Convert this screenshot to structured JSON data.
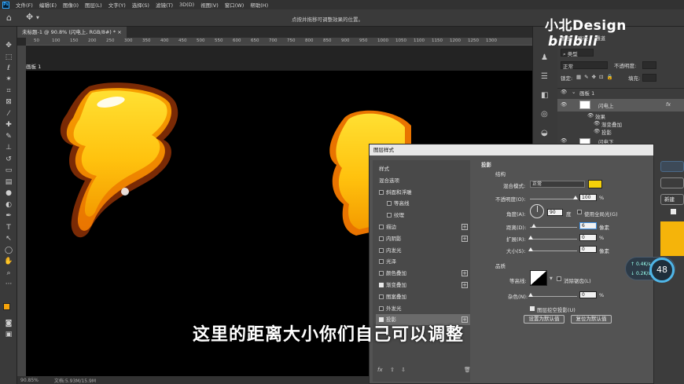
{
  "menubar": {
    "app_icon": "Ps",
    "items": [
      "文件(F)",
      "编辑(E)",
      "图像(I)",
      "图层(L)",
      "文字(Y)",
      "选择(S)",
      "滤镜(T)",
      "3D(D)",
      "视图(V)",
      "窗口(W)",
      "帮助(H)"
    ]
  },
  "options_bar": {
    "hint": "点按并拖移可调整效果的位置。"
  },
  "document": {
    "tab_label": "未标题-1 @ 90.8% (闪电上, RGB/8#) *",
    "artboard_label": "画板 1",
    "ruler_ticks": [
      "50",
      "100",
      "150",
      "200",
      "250",
      "300",
      "350",
      "400",
      "450",
      "500",
      "550",
      "600",
      "650",
      "700",
      "750",
      "800",
      "850",
      "900",
      "950",
      "1000",
      "1050",
      "1100",
      "1150",
      "1200",
      "1250",
      "1300"
    ]
  },
  "status": {
    "zoom": "90.85%",
    "doc_size": "文档:5.93M/15.9M"
  },
  "watermark": {
    "brand": "小北Design",
    "site": "bilibili"
  },
  "layers_panel": {
    "tabs": [
      "图层",
      "路径",
      "通道"
    ],
    "filter_label": "类型",
    "blend_mode": "正常",
    "opacity_label": "不透明度:",
    "lock_label": "锁定:",
    "fill_label": "填充:",
    "rows": [
      {
        "name": "画板 1"
      },
      {
        "name": "闪电上",
        "fx": "fx"
      },
      {
        "name": "效果"
      },
      {
        "name": "渐变叠加"
      },
      {
        "name": "投影"
      },
      {
        "name": "闪电下"
      }
    ]
  },
  "layer_style": {
    "title": "图层样式",
    "left_items": [
      {
        "label": "样式",
        "checkbox": false,
        "checked": false,
        "plus": false,
        "indent": 0
      },
      {
        "label": "混合选项",
        "checkbox": false,
        "checked": false,
        "plus": false,
        "indent": 0
      },
      {
        "label": "斜面和浮雕",
        "checkbox": true,
        "checked": false,
        "plus": false,
        "indent": 0
      },
      {
        "label": "等高线",
        "checkbox": true,
        "checked": false,
        "plus": false,
        "indent": 1
      },
      {
        "label": "纹理",
        "checkbox": true,
        "checked": false,
        "plus": false,
        "indent": 1
      },
      {
        "label": "描边",
        "checkbox": true,
        "checked": false,
        "plus": true,
        "indent": 0
      },
      {
        "label": "内阴影",
        "checkbox": true,
        "checked": false,
        "plus": true,
        "indent": 0
      },
      {
        "label": "内发光",
        "checkbox": true,
        "checked": false,
        "plus": false,
        "indent": 0
      },
      {
        "label": "光泽",
        "checkbox": true,
        "checked": false,
        "plus": false,
        "indent": 0
      },
      {
        "label": "颜色叠加",
        "checkbox": true,
        "checked": false,
        "plus": true,
        "indent": 0
      },
      {
        "label": "渐变叠加",
        "checkbox": true,
        "checked": true,
        "plus": true,
        "indent": 0
      },
      {
        "label": "图案叠加",
        "checkbox": true,
        "checked": false,
        "plus": false,
        "indent": 0
      },
      {
        "label": "外发光",
        "checkbox": true,
        "checked": false,
        "plus": false,
        "indent": 0
      },
      {
        "label": "投影",
        "checkbox": true,
        "checked": true,
        "plus": true,
        "indent": 0,
        "selected": true
      }
    ],
    "section_title": "投影",
    "structure": "结构",
    "blend_label": "混合模式:",
    "blend_value": "正常",
    "shadow_color": "#f5d10a",
    "opacity_label": "不透明度(O):",
    "opacity_value": "100",
    "percent": "%",
    "angle_label": "角度(A):",
    "angle_value": "90",
    "degree": "度",
    "global_light": "使用全局光(G)",
    "distance_label": "距离(D):",
    "distance_value": "6",
    "spread_label": "扩展(R):",
    "spread_value": "0",
    "size_label": "大小(S):",
    "size_value": "0",
    "px": "像素",
    "quality": "品质",
    "contour_label": "等高线:",
    "antialias": "消除锯齿(L)",
    "noise_label": "杂色(N):",
    "noise_value": "0",
    "knockout": "图层挖空投影(U)",
    "btn_default": "设置为默认值",
    "btn_reset": "复位为默认值",
    "fx": "fx"
  },
  "right_buttons": {
    "new_style": "新建"
  },
  "network": {
    "up": "0.4",
    "down": "0.2",
    "unit": "K/s",
    "percent": "48"
  },
  "subtitle": "这里的距离大小你们自己可以调整",
  "colors": {
    "foreground": "#f5a30a",
    "background": "#ffffff",
    "bolt_light": "#ffd21a",
    "bolt_dark": "#f08a00",
    "bolt_outline": "#7a2a05"
  }
}
